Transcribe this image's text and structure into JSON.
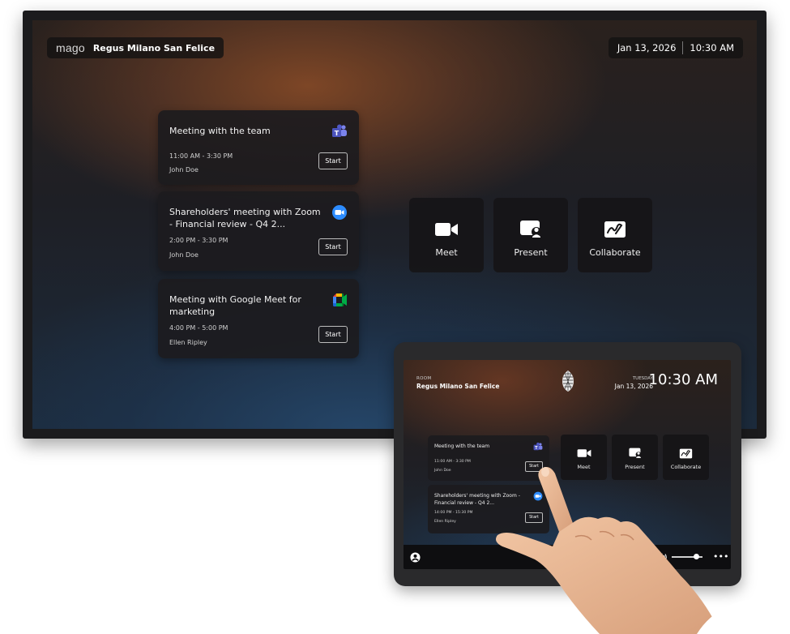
{
  "tv": {
    "brand": "mago",
    "room_name": "Regus Milano San Felice",
    "date": "Jan 13, 2026",
    "time": "10:30 AM",
    "meetings": [
      {
        "title": "Meeting with the team",
        "time": "11:00 AM - 3:30 PM",
        "organizer": "John Doe",
        "start_label": "Start",
        "platform_icon": "microsoft-teams-icon"
      },
      {
        "title": "Shareholders' meeting with Zoom - Financial review - Q4 2...",
        "time": "2:00 PM - 3:30 PM",
        "organizer": "John Doe",
        "start_label": "Start",
        "platform_icon": "zoom-icon"
      },
      {
        "title": "Meeting with Google Meet for marketing",
        "time": "4:00 PM - 5:00 PM",
        "organizer": "Ellen Ripley",
        "start_label": "Start",
        "platform_icon": "google-meet-icon"
      }
    ],
    "actions": [
      {
        "label": "Meet",
        "icon": "video-camera-icon"
      },
      {
        "label": "Present",
        "icon": "present-icon"
      },
      {
        "label": "Collaborate",
        "icon": "whiteboard-icon"
      }
    ]
  },
  "tablet": {
    "room_label": "ROOM",
    "room_name": "Regus Milano San Felice",
    "day": "TUESDAY",
    "date": "Jan 13, 2026",
    "time": "10:30 AM",
    "meetings": [
      {
        "title": "Meeting with the team",
        "time": "11:00 AM - 3:30 PM",
        "organizer": "John Doe",
        "start_label": "Start",
        "platform_icon": "microsoft-teams-icon"
      },
      {
        "title": "Shareholders' meeting with Zoom - Financial review - Q4 2...",
        "time": "14:00 PM - 15:30 PM",
        "organizer": "Ellen Ripley",
        "start_label": "Start",
        "platform_icon": "zoom-icon"
      }
    ],
    "actions": [
      {
        "label": "Meet",
        "icon": "video-camera-icon"
      },
      {
        "label": "Present",
        "icon": "present-icon"
      },
      {
        "label": "Collaborate",
        "icon": "whiteboard-icon"
      }
    ],
    "volume": 0.8
  },
  "colors": {
    "teams": "#5059C9",
    "zoom": "#2D8CFF",
    "meet_green": "#00AC47",
    "meet_yellow": "#FFBA00",
    "meet_red": "#EA4335",
    "meet_blue": "#4285F4"
  }
}
